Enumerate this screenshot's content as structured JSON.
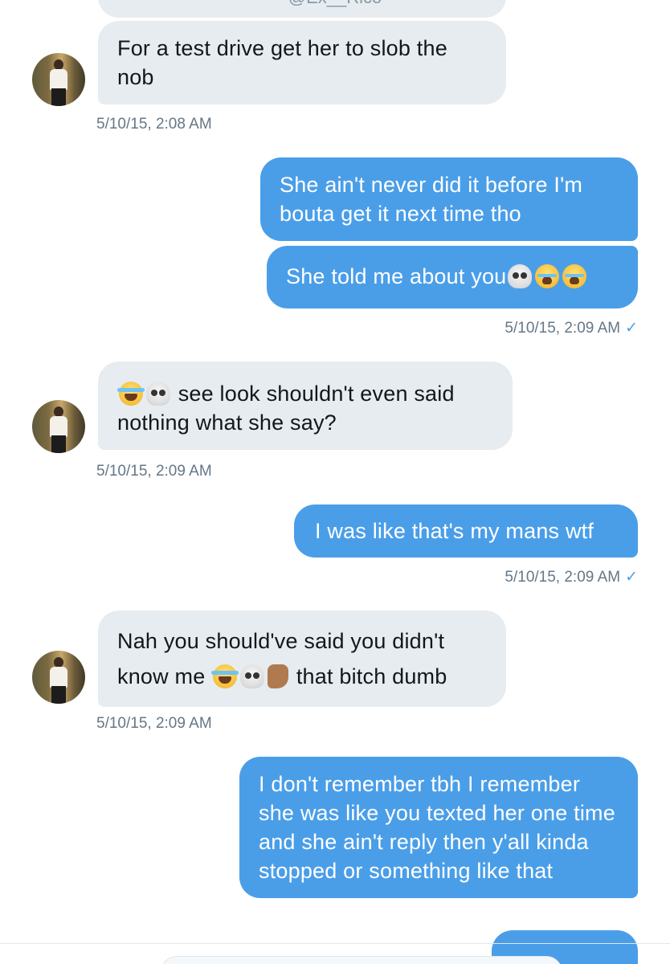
{
  "header": {
    "handle_partial": "@Ex__Rico"
  },
  "messages": [
    {
      "direction": "incoming",
      "text": "For a test drive get her to slob the nob",
      "timestamp": "5/10/15, 2:08 AM"
    },
    {
      "direction": "outgoing",
      "text": "She ain't never did it before I'm bouta get it next time tho"
    },
    {
      "direction": "outgoing",
      "text": "She told me about you",
      "emoji": [
        "skull-icon",
        "loudly-crying-face-icon",
        "loudly-crying-face-icon"
      ],
      "timestamp": "5/10/15, 2:09 AM",
      "read": true
    },
    {
      "direction": "incoming",
      "emoji_prefix": [
        "tears-of-joy-icon",
        "skull-icon"
      ],
      "text": "see look shouldn't even said nothing what she say?",
      "timestamp": "5/10/15, 2:09 AM"
    },
    {
      "direction": "outgoing",
      "text": "I was like that's my mans wtf",
      "timestamp": "5/10/15, 2:09 AM",
      "read": true
    },
    {
      "direction": "incoming",
      "text_before": "Nah you should've said you didn't know me",
      "emoji": [
        "tears-of-joy-icon",
        "skull-icon",
        "thumbs-down-icon"
      ],
      "text_after": "that bitch dumb",
      "timestamp": "5/10/15, 2:09 AM"
    },
    {
      "direction": "outgoing",
      "text": "I don't remember tbh I remember she was like you texted her one time and she ain't reply then y'all kinda stopped or something like that"
    }
  ],
  "read_check": "✓",
  "colors": {
    "incoming_bubble": "#e6ecf0",
    "outgoing_bubble": "#4a9ee8",
    "timestamp": "#657786",
    "read_check": "#4a9ee8"
  }
}
